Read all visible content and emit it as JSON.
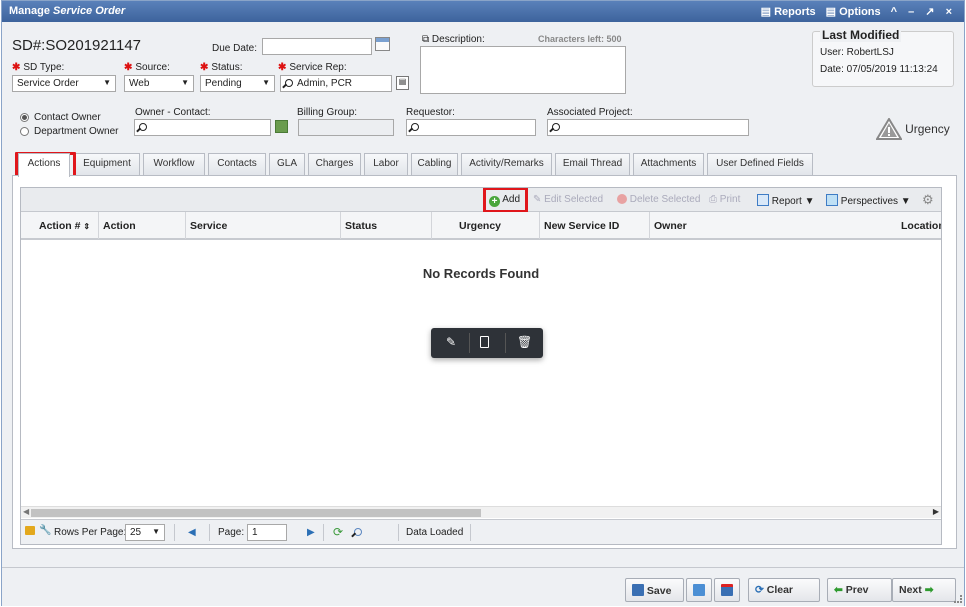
{
  "title": {
    "prefix": "Manage",
    "italic": "Service Order",
    "reports": "Reports",
    "options": "Options",
    "ctrls": "^ – ↗ ×"
  },
  "header": {
    "sd_label": "SD#:",
    "sd_value": "SO201921147",
    "due_date_label": "Due Date:",
    "due_date_value": "",
    "description_label": "Description:",
    "chars_left": "Characters left: 500",
    "sd_type_label": "SD Type:",
    "sd_type_value": "Service Order",
    "source_label": "Source:",
    "source_value": "Web",
    "status_label": "Status:",
    "status_value": "Pending",
    "rep_label": "Service Rep:",
    "rep_value": "Admin, PCR",
    "contact_owner": "Contact Owner",
    "dept_owner": "Department Owner",
    "owner_contact_label": "Owner - Contact:",
    "billing_label": "Billing Group:",
    "requestor_label": "Requestor:",
    "project_label": "Associated Project:",
    "urgency_label": "Urgency"
  },
  "last_modified": {
    "title": "Last Modified",
    "user": "User: RobertLSJ",
    "date": "Date: 07/05/2019 11:13:24"
  },
  "tabs": [
    "Actions",
    "Equipment",
    "Workflow",
    "Contacts",
    "GLA",
    "Charges",
    "Labor",
    "Cabling",
    "Activity/Remarks",
    "Email Thread",
    "Attachments",
    "User Defined Fields"
  ],
  "toolbar": {
    "add": "Add",
    "edit": "Edit Selected",
    "delete": "Delete Selected",
    "print": "Print",
    "report": "Report",
    "perspectives": "Perspectives"
  },
  "columns": [
    "Action #",
    "Action",
    "Service",
    "Status",
    "Urgency",
    "New Service ID",
    "Owner",
    "Location"
  ],
  "empty_text": "No Records Found",
  "pager": {
    "rows_label": "Rows Per Page:",
    "rows_value": "25",
    "page_label": "Page:",
    "page_value": "1",
    "status": "Data Loaded"
  },
  "bottom": {
    "save": "Save",
    "clear": "Clear",
    "prev": "Prev",
    "next": "Next"
  },
  "colors": {
    "title_bar": "#4a72ad",
    "highlight": "#e0161b",
    "required": "#d11111"
  }
}
